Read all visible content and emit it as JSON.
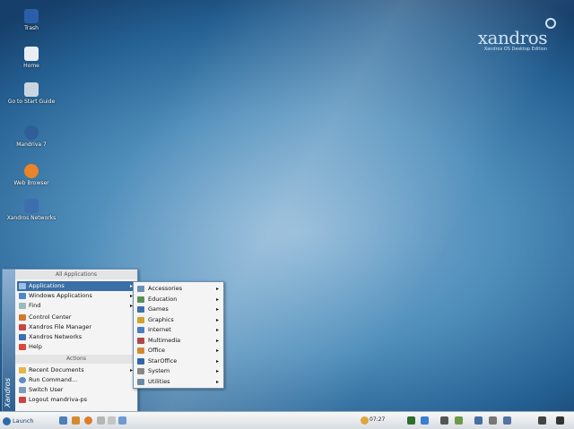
{
  "desktop": {
    "icons": [
      {
        "label": "Trash",
        "icon": "trash-icon",
        "color": "#2a5ea8"
      },
      {
        "label": "Home",
        "icon": "home-icon",
        "color": "#e8eef4"
      },
      {
        "label": "Go to Start Guide",
        "icon": "start-guide-icon",
        "color": "#c9d6e2"
      },
      {
        "label": "Mandriva 7",
        "icon": "mandriva-icon",
        "color": "#2f5e99"
      },
      {
        "label": "Web Browser",
        "icon": "firefox-icon",
        "color": "#e8842a"
      },
      {
        "label": "Xandros Networks",
        "icon": "xandros-networks-icon",
        "color": "#3d6fb0"
      }
    ]
  },
  "logo": {
    "name": "xandros",
    "tagline": "Xandros OS Desktop Edition"
  },
  "start_menu": {
    "header": "All Applications",
    "side_label": "Xandros",
    "items": [
      {
        "label": "Applications",
        "submenu": true,
        "highlighted": true,
        "icon": "applications-icon",
        "color": "#3b6fa7"
      },
      {
        "label": "Windows Applications",
        "submenu": true,
        "icon": "windows-apps-icon",
        "color": "#4f86c6"
      },
      {
        "label": "Find",
        "submenu": true,
        "icon": "find-icon",
        "color": "#9bb"
      },
      {
        "label": "Control Center",
        "icon": "control-center-icon",
        "color": "#d07b2a"
      },
      {
        "label": "Xandros File Manager",
        "icon": "file-manager-icon",
        "color": "#c94545"
      },
      {
        "label": "Xandros Networks",
        "icon": "networks-icon",
        "color": "#3d6fb0"
      },
      {
        "label": "Help",
        "icon": "help-icon",
        "color": "#d64a3a"
      }
    ],
    "section_label": "Actions",
    "actions": [
      {
        "label": "Recent Documents",
        "submenu": true,
        "icon": "recent-docs-icon",
        "color": "#e7b44a"
      },
      {
        "label": "Run Command...",
        "icon": "run-icon",
        "color": "#5a8ec5"
      },
      {
        "label": "Switch User",
        "icon": "switch-user-icon",
        "color": "#7d9bbb"
      },
      {
        "label": "Logout mandriva-ps",
        "icon": "logout-icon",
        "color": "#c94545"
      }
    ]
  },
  "submenu": {
    "items": [
      {
        "label": "Accessories",
        "icon": "accessories-icon",
        "color": "#6b8fb8"
      },
      {
        "label": "Education",
        "icon": "education-icon",
        "color": "#5a8f5a"
      },
      {
        "label": "Games",
        "icon": "games-icon",
        "color": "#3c6fb0"
      },
      {
        "label": "Graphics",
        "icon": "graphics-icon",
        "color": "#d4a030"
      },
      {
        "label": "Internet",
        "icon": "internet-icon",
        "color": "#4a7fc1"
      },
      {
        "label": "Multimedia",
        "icon": "multimedia-icon",
        "color": "#b04848"
      },
      {
        "label": "Office",
        "icon": "office-icon",
        "color": "#d38a2e"
      },
      {
        "label": "StarOffice",
        "icon": "staroffice-icon",
        "color": "#2f67a8"
      },
      {
        "label": "System",
        "icon": "system-icon",
        "color": "#888888"
      },
      {
        "label": "Utilities",
        "icon": "utilities-icon",
        "color": "#6d8aa5"
      }
    ]
  },
  "taskbar": {
    "launch_label": "Launch",
    "clock": "07:27",
    "quick_icons": [
      {
        "icon": "desktop-icon",
        "color": "#4d7fb8"
      },
      {
        "icon": "home-icon",
        "color": "#d18b2d"
      },
      {
        "icon": "browser-icon",
        "color": "#e07b28"
      },
      {
        "icon": "files-icon",
        "color": "#b5b5b5"
      },
      {
        "icon": "mail-icon",
        "color": "#c4c4c4"
      },
      {
        "icon": "office-icon",
        "color": "#6d9ad0"
      }
    ],
    "tray_icons": [
      {
        "icon": "network-icon",
        "color": "#2d6e2d"
      },
      {
        "icon": "update-icon",
        "color": "#3a7fcf"
      },
      {
        "icon": "volume-icon",
        "color": "#555555"
      },
      {
        "icon": "battery-icon",
        "color": "#6a9a4a"
      },
      {
        "icon": "display-icon",
        "color": "#466fa0"
      },
      {
        "icon": "clipboard-icon",
        "color": "#777777"
      },
      {
        "icon": "keyboard-icon",
        "color": "#5573a2"
      },
      {
        "icon": "search-icon",
        "color": "#444444"
      },
      {
        "icon": "power-icon",
        "color": "#333333"
      }
    ]
  }
}
